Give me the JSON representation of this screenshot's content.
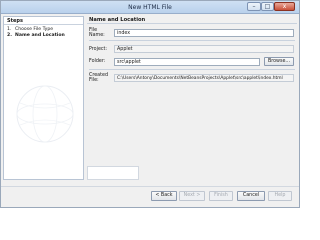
{
  "window": {
    "title": "New HTML File",
    "minimize": "–",
    "maximize": "□",
    "close": "x"
  },
  "steps": {
    "heading": "Steps",
    "items": [
      {
        "num": "1.",
        "label": "Choose File Type"
      },
      {
        "num": "2.",
        "label": "Name and Location"
      }
    ]
  },
  "panel": {
    "title": "Name and Location",
    "file_name_label": "File Name:",
    "file_name_value": "index",
    "project_label": "Project:",
    "project_value": "Applet",
    "folder_label": "Folder:",
    "folder_value": "src\\applet",
    "browse_label": "Browse...",
    "created_file_label": "Created File:",
    "created_file_value": "C:\\Users\\Antony\\Documents\\NetBeansProjects\\Applet\\src\\applet\\index.html"
  },
  "buttons": {
    "back": "< Back",
    "next": "Next >",
    "finish": "Finish",
    "cancel": "Cancel",
    "help": "Help"
  }
}
